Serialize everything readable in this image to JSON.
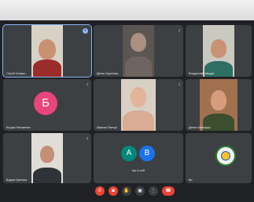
{
  "participants": [
    {
      "name": "Сергій Сахаро..."
    },
    {
      "name": "Денис Корнієнко"
    },
    {
      "name": "Владислав Швидка"
    },
    {
      "name": "Богдан Пахоменко",
      "avatar_letter": "Б",
      "avatar_color": "#e8457a"
    },
    {
      "name": "Максим Панчук"
    },
    {
      "name": "Денис Шинкарук"
    },
    {
      "name": "Вадим Гуменюк"
    },
    {
      "name": "Ви"
    }
  ],
  "group_tile": {
    "label": "Ще 6 осіб",
    "avatars": [
      {
        "letter": "A",
        "color": "#00897b"
      },
      {
        "letter": "B",
        "color": "#1a73e8"
      }
    ]
  },
  "icons": {
    "mic_muted": "mic-off-icon",
    "pinned": "pin-icon",
    "logo": "school-emblem-icon"
  },
  "controls": [
    {
      "name": "mic-toggle-button",
      "icon": "mic-off-icon",
      "glyph": "✆"
    },
    {
      "name": "camera-toggle-button",
      "icon": "camera-off-icon",
      "glyph": "◙"
    },
    {
      "name": "raise-hand-button",
      "icon": "hand-icon",
      "glyph": "✋"
    },
    {
      "name": "present-button",
      "icon": "present-icon",
      "glyph": "▣"
    },
    {
      "name": "more-options-button",
      "icon": "more-vert-icon",
      "glyph": "⋮"
    },
    {
      "name": "end-call-button",
      "icon": "end-call-icon",
      "glyph": "☎"
    }
  ],
  "colors": {
    "tile_background": "#3c4043",
    "stage_background": "#202124",
    "active_outline": "#8ab4f8",
    "end_call": "#ea4335"
  }
}
